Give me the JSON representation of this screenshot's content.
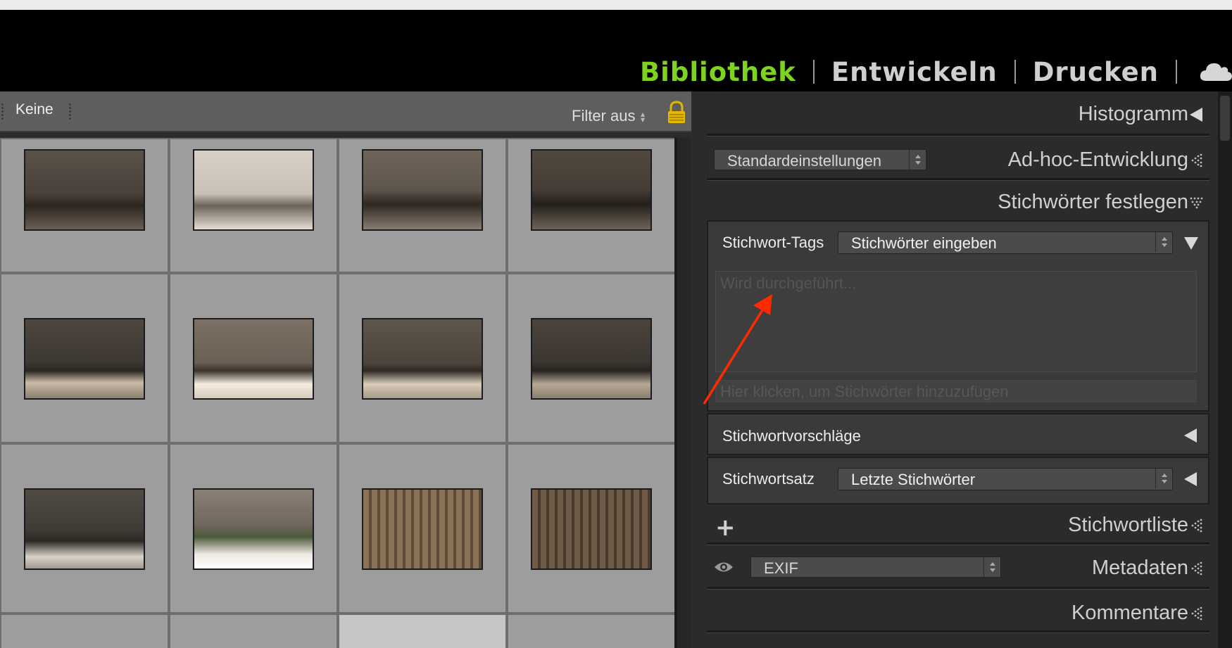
{
  "modules": {
    "library": "Bibliothek",
    "develop": "Entwickeln",
    "print": "Drucken"
  },
  "filterbar": {
    "collection": "Keine",
    "filter": "Filter aus"
  },
  "panel": {
    "histogram": "Histogramm",
    "quick_develop": {
      "title": "Ad-hoc-Entwicklung",
      "preset": "Standardeinstellungen"
    },
    "keywording": {
      "title": "Stichwörter festlegen",
      "tags_label": "Stichwort-Tags",
      "tags_select": "Stichwörter eingeben",
      "textarea_placeholder": "Wird durchgeführt...",
      "add_placeholder": "Hier klicken, um Stichwörter hinzuzufügen",
      "suggestions": "Stichwortvorschläge",
      "set_label": "Stichwortsatz",
      "set_select": "Letzte Stichwörter"
    },
    "keyword_list": "Stichwortliste",
    "metadata": {
      "title": "Metadaten",
      "preset": "EXIF"
    },
    "comments": "Kommentare"
  },
  "colors": {
    "active_module": "#7ed321",
    "annotation_arrow": "#ff2a00"
  },
  "icons": [
    "cloud-icon",
    "lock-icon",
    "plus-icon",
    "eye-icon",
    "collapse-triangle-icon"
  ]
}
